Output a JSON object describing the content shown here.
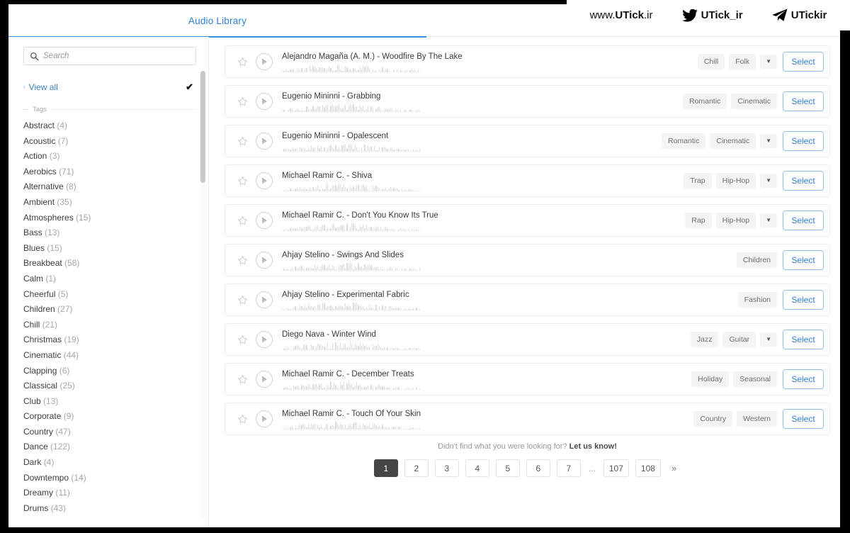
{
  "tabs": [
    {
      "label": "Audio Library",
      "active": true
    }
  ],
  "sidebar": {
    "search": {
      "placeholder": "Search",
      "value": ""
    },
    "view_all": {
      "label": "View all",
      "checked": true,
      "check_glyph": "✔",
      "chevron_glyph": "›"
    },
    "tags_divider_label": "Tags",
    "tags": [
      {
        "name": "Abstract",
        "count": "(4)"
      },
      {
        "name": "Acoustic",
        "count": "(7)"
      },
      {
        "name": "Action",
        "count": "(3)"
      },
      {
        "name": "Aerobics",
        "count": "(71)"
      },
      {
        "name": "Alternative",
        "count": "(8)"
      },
      {
        "name": "Ambient",
        "count": "(35)"
      },
      {
        "name": "Atmospheres",
        "count": "(15)"
      },
      {
        "name": "Bass",
        "count": "(13)"
      },
      {
        "name": "Blues",
        "count": "(15)"
      },
      {
        "name": "Breakbeat",
        "count": "(58)"
      },
      {
        "name": "Calm",
        "count": "(1)"
      },
      {
        "name": "Cheerful",
        "count": "(5)"
      },
      {
        "name": "Children",
        "count": "(27)"
      },
      {
        "name": "Chill",
        "count": "(21)"
      },
      {
        "name": "Christmas",
        "count": "(19)"
      },
      {
        "name": "Cinematic",
        "count": "(44)"
      },
      {
        "name": "Clapping",
        "count": "(6)"
      },
      {
        "name": "Classical",
        "count": "(25)"
      },
      {
        "name": "Club",
        "count": "(13)"
      },
      {
        "name": "Corporate",
        "count": "(9)"
      },
      {
        "name": "Country",
        "count": "(47)"
      },
      {
        "name": "Dance",
        "count": "(122)"
      },
      {
        "name": "Dark",
        "count": "(4)"
      },
      {
        "name": "Downtempo",
        "count": "(14)"
      },
      {
        "name": "Dreamy",
        "count": "(11)"
      },
      {
        "name": "Drums",
        "count": "(43)"
      }
    ]
  },
  "tracks": [
    {
      "title": "Alejandro Magaña (A. M.) - Woodfire By The Lake",
      "tags": [
        "Chill",
        "Folk"
      ],
      "has_more": true,
      "select_label": "Select",
      "wave_seed": 11
    },
    {
      "title": "Eugenio Mininni - Grabbing",
      "tags": [
        "Romantic",
        "Cinematic"
      ],
      "has_more": false,
      "select_label": "Select",
      "wave_seed": 23
    },
    {
      "title": "Eugenio Mininni - Opalescent",
      "tags": [
        "Romantic",
        "Cinematic"
      ],
      "has_more": true,
      "select_label": "Select",
      "wave_seed": 37
    },
    {
      "title": "Michael Ramir C. - Shiva",
      "tags": [
        "Trap",
        "Hip-Hop"
      ],
      "has_more": true,
      "select_label": "Select",
      "wave_seed": 51
    },
    {
      "title": "Michael Ramir C. - Don't You Know Its True",
      "tags": [
        "Rap",
        "Hip-Hop"
      ],
      "has_more": true,
      "select_label": "Select",
      "wave_seed": 67
    },
    {
      "title": "Ahjay Stelino - Swings And Slides",
      "tags": [
        "Children"
      ],
      "has_more": false,
      "select_label": "Select",
      "wave_seed": 83
    },
    {
      "title": "Ahjay Stelino - Experimental Fabric",
      "tags": [
        "Fashion"
      ],
      "has_more": false,
      "select_label": "Select",
      "wave_seed": 97
    },
    {
      "title": "Diego Nava - Winter Wind",
      "tags": [
        "Jazz",
        "Guitar"
      ],
      "has_more": true,
      "select_label": "Select",
      "wave_seed": 113
    },
    {
      "title": "Michael Ramir C. - December Treats",
      "tags": [
        "Holiday",
        "Seasonal"
      ],
      "has_more": false,
      "select_label": "Select",
      "wave_seed": 129
    },
    {
      "title": "Michael Ramir C. - Touch Of Your Skin",
      "tags": [
        "Country",
        "Western"
      ],
      "has_more": false,
      "select_label": "Select",
      "wave_seed": 147
    }
  ],
  "footer": {
    "note_prefix": "Didn't find what you were looking for? ",
    "note_link": "Let us know!",
    "pagination": {
      "pages": [
        "1",
        "2",
        "3",
        "4",
        "5",
        "6",
        "7"
      ],
      "ellipsis": "...",
      "tail_pages": [
        "107",
        "108"
      ],
      "next_glyph": "»",
      "active": "1"
    }
  },
  "watermark": {
    "url_light": "www.",
    "url_bold": "UTick",
    "url_tail": ".ir",
    "twitter_handle": "UTick_ir",
    "telegram_handle": "UTickir"
  },
  "colors": {
    "accent_blue": "#2a7fd4",
    "tab_underline": "#3a8ee0",
    "active_page_bg": "#454545",
    "chip_bg": "#f4f4f4",
    "waveform": "#d7d7d7"
  }
}
